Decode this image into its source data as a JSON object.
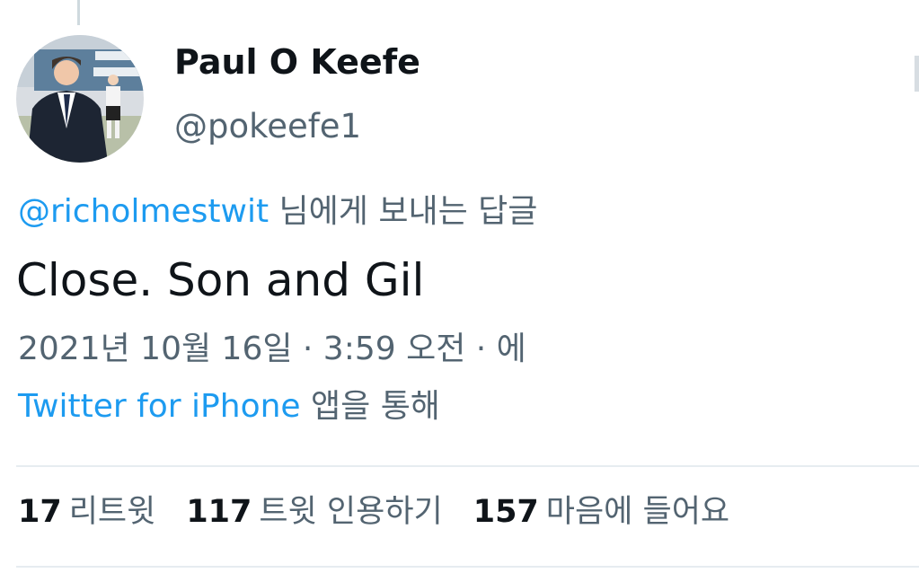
{
  "author": {
    "display_name": "Paul O Keefe",
    "handle": "@pokeefe1"
  },
  "reply": {
    "mention": "@richolmestwit",
    "suffix": " 님에게 보내는 답글"
  },
  "tweet": {
    "text": "Close. Son and Gil",
    "timestamp": "2021년 10월 16일 · 3:59 오전 · 에",
    "source_app": "Twitter for iPhone",
    "source_suffix": " 앱을 통해"
  },
  "stats": {
    "retweets": {
      "count": "17",
      "label": "리트윗"
    },
    "quotes": {
      "count": "117",
      "label": "트윗 인용하기"
    },
    "likes": {
      "count": "157",
      "label": "마음에 들어요"
    }
  },
  "colors": {
    "link": "#1d9bf0",
    "secondary_text": "#536471",
    "primary_text": "#0f1419",
    "divider": "#e6ecf0"
  }
}
